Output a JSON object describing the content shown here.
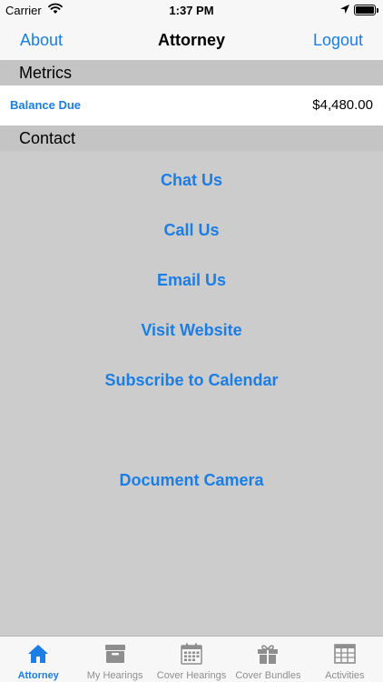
{
  "status_bar": {
    "carrier": "Carrier",
    "time": "1:37 PM"
  },
  "nav": {
    "left": "About",
    "title": "Attorney",
    "right": "Logout"
  },
  "sections": {
    "metrics": "Metrics",
    "contact": "Contact"
  },
  "metrics": {
    "balance_label": "Balance Due",
    "balance_value": "$4,480.00"
  },
  "contact_links": [
    "Chat Us",
    "Call Us",
    "Email Us",
    "Visit Website",
    "Subscribe to Calendar",
    "Document Camera"
  ],
  "tabs": [
    {
      "label": "Attorney",
      "icon": "house-icon",
      "active": true
    },
    {
      "label": "My Hearings",
      "icon": "archive-box-icon",
      "active": false
    },
    {
      "label": "Cover Hearings",
      "icon": "calendar-icon",
      "active": false
    },
    {
      "label": "Cover Bundles",
      "icon": "gift-icon",
      "active": false
    },
    {
      "label": "Activities",
      "icon": "table-grid-icon",
      "active": false
    }
  ],
  "colors": {
    "accent": "#1a7ee6",
    "inactive_tab": "#8e8e8e",
    "background": "#cccccc",
    "section_header": "#c4c4c4"
  }
}
